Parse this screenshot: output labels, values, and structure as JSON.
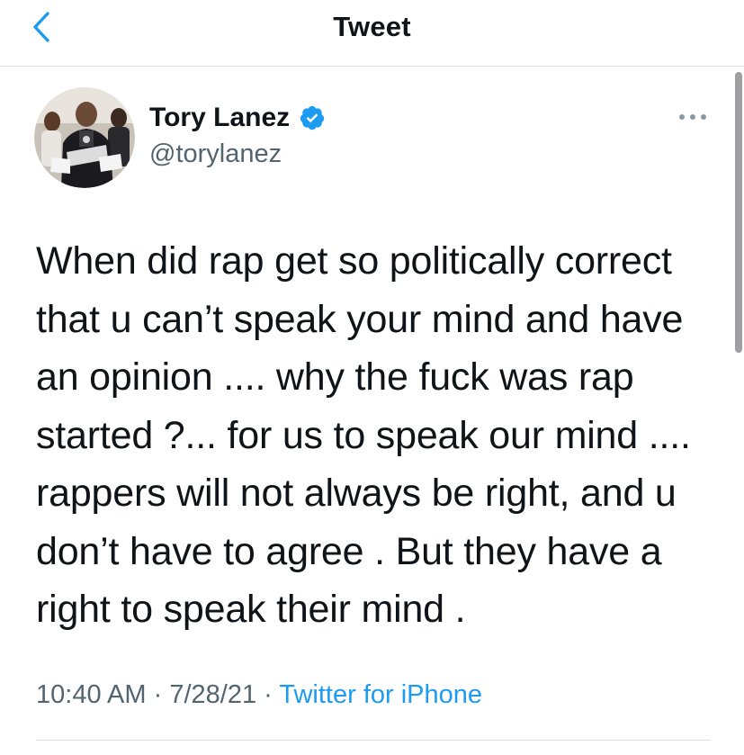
{
  "header": {
    "title": "Tweet",
    "back_icon": "chevron-left-icon",
    "accent_color": "#1d9bf0"
  },
  "author": {
    "name": "Tory Lanez",
    "handle": "@torylanez",
    "verified": true,
    "verified_icon": "verified-badge-icon",
    "avatar_icon": "avatar"
  },
  "more_menu_icon": "ellipsis-icon",
  "tweet": {
    "text": "When did rap get so politically correct\nthat u can’t speak your mind and have\nan opinion .... why the fuck was rap\nstarted ?... for us to speak our mind ....\nrappers will not always be right, and u\ndon’t have to agree . But they have a\nright to speak their mind .",
    "time": "10:40 AM",
    "separator": "·",
    "date": "7/28/21",
    "source": "Twitter for iPhone"
  },
  "colors": {
    "text_primary": "#0f1419",
    "text_secondary": "#536471",
    "link": "#1d9bf0",
    "divider": "#d9dde1"
  }
}
